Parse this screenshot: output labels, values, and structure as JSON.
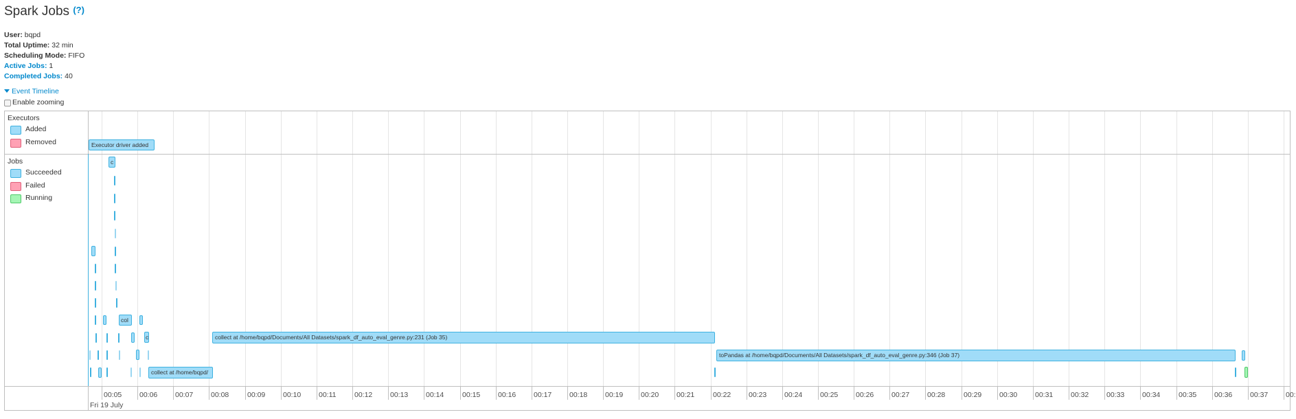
{
  "header": {
    "title": "Spark Jobs",
    "help_mark": "(?)"
  },
  "summary": {
    "user_label": "User:",
    "user_value": "bqpd",
    "uptime_label": "Total Uptime:",
    "uptime_value": "32 min",
    "sched_label": "Scheduling Mode:",
    "sched_value": "FIFO",
    "active_label": "Active Jobs:",
    "active_value": "1",
    "completed_label": "Completed Jobs:",
    "completed_value": "40"
  },
  "timeline_toggle": "Event Timeline",
  "zoom_label": "Enable zooming",
  "legend": {
    "executors_title": "Executors",
    "added": "Added",
    "removed": "Removed",
    "jobs_title": "Jobs",
    "succeeded": "Succeeded",
    "failed": "Failed",
    "running": "Running"
  },
  "colors": {
    "succeeded_fill": "#a0dcf8",
    "succeeded_border": "#3eb1e0",
    "removed_fill": "#ffa1b4",
    "running_fill": "#a4f5b4",
    "link": "#0088cc"
  },
  "executor_event": "Executor driver added",
  "jobs": [
    {
      "label": "c"
    },
    {
      "label": "col"
    },
    {
      "label": "c"
    },
    {
      "label": "collect at /home/bqpd/Documents/All Datasets/spark_df_auto_eval_genre.py:231 (Job 35)"
    },
    {
      "label": "toPandas at /home/bqpd/Documents/All Datasets/spark_df_auto_eval_genre.py:346 (Job 37)"
    },
    {
      "label": "collect at /home/bqpd/"
    }
  ],
  "axis": {
    "labels": [
      "00:05",
      "00:06",
      "00:07",
      "00:08",
      "00:09",
      "00:10",
      "00:11",
      "00:12",
      "00:13",
      "00:14",
      "00:15",
      "00:16",
      "00:17",
      "00:18",
      "00:19",
      "00:20",
      "00:21",
      "00:22",
      "00:23",
      "00:24",
      "00:25",
      "00:26",
      "00:27",
      "00:28",
      "00:29",
      "00:30",
      "00:31",
      "00:32",
      "00:33",
      "00:34",
      "00:35",
      "00:36",
      "00:37",
      "00:"
    ],
    "date": "Fri 19 July"
  }
}
